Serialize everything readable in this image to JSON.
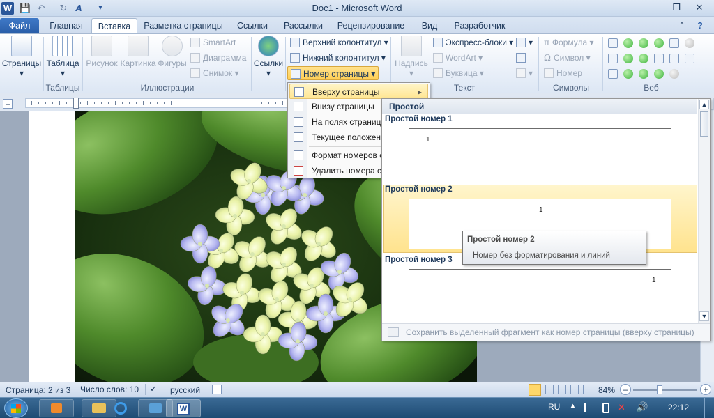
{
  "window": {
    "title": "Doc1 - Microsoft Word",
    "minimize": "–",
    "restore": "❐",
    "close": "✕"
  },
  "quick_access": [
    "W",
    "💾",
    "↶",
    "↻",
    "A",
    "▾"
  ],
  "tabs": [
    "Файл",
    "Главная",
    "Вставка",
    "Разметка страницы",
    "Ссылки",
    "Рассылки",
    "Рецензирование",
    "Вид",
    "Разработчик"
  ],
  "ribbon": {
    "pages": {
      "label": "Страницы"
    },
    "tables": {
      "table_label": "Таблица",
      "group_label": "Таблицы"
    },
    "illustrations": {
      "picture": "Рисунок",
      "clipart": "Картинка",
      "shapes": "Фигуры",
      "smartart": "SmartArt",
      "chart": "Диаграмма",
      "screenshot": "Снимок",
      "group_label": "Иллюстрации"
    },
    "links": {
      "label": "Ссылки"
    },
    "header_footer": {
      "header": "Верхний колонтитул",
      "footer": "Нижний колонтитул",
      "page_number": "Номер страницы"
    },
    "text": {
      "textbox": "Надпись",
      "quickparts": "Экспресс-блоки",
      "wordart": "WordArt",
      "dropcap": "Буквица",
      "group_label": "Текст"
    },
    "symbols": {
      "equation": "Формула",
      "symbol": "Символ",
      "number": "Номер",
      "group_label": "Символы"
    },
    "web": {
      "group_label": "Веб"
    }
  },
  "page_number_menu": [
    {
      "label": "Вверху страницы",
      "arrow": "▸"
    },
    {
      "label": "Внизу страницы",
      "arrow": "▸"
    },
    {
      "label": "На полях страницы",
      "arrow": "▸"
    },
    {
      "label": "Текущее положение",
      "arrow": "▸"
    },
    {
      "label": "Формат номеров страниц..."
    },
    {
      "label": "Удалить номера страниц"
    }
  ],
  "gallery": {
    "header": "Простой",
    "items": [
      {
        "title": "Простой номер 1",
        "number": "1"
      },
      {
        "title": "Простой номер 2",
        "number": "1"
      },
      {
        "title": "Простой номер 3",
        "number": "1"
      }
    ],
    "footer": "Сохранить выделенный фрагмент как номер страницы (вверху страницы)"
  },
  "tooltip": {
    "title": "Простой номер 2",
    "description": "Номер без форматирования и линий"
  },
  "status": {
    "page": "Страница: 2 из 3",
    "words": "Число слов: 10",
    "language": "русский",
    "zoom": "84%",
    "zoom_minus": "–",
    "zoom_plus": "+"
  },
  "taskbar": {
    "lang": "RU",
    "time": "22:12"
  },
  "colors": {
    "accent": "#2a5ea8",
    "highlight": "#ffe38e",
    "web_green": "#3fb43f"
  }
}
